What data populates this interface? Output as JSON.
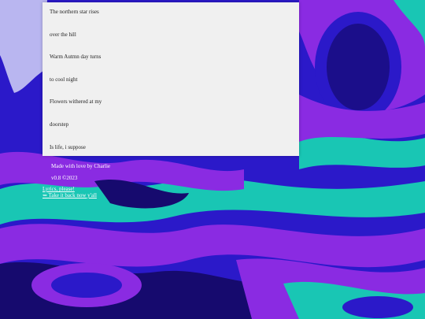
{
  "lyrics": [
    "The northern star rises",
    "over the hill",
    "Warm Autmn day turns",
    "to cool night",
    "Flowers withered at my",
    "doorstep",
    "Is life, i suppose"
  ],
  "footer": {
    "credit": "Made with love by Charlie",
    "version": "v0.8 ©2023",
    "lyrics_link": "Lyrics, please!",
    "back_link": "⇐ Take it back now y'all"
  },
  "colors": {
    "deep_blue": "#2b19c9",
    "purple": "#8a2be2",
    "teal": "#19c6b4",
    "navy": "#160a6e",
    "lavender": "#b9b6f0",
    "panel": "#f0f0f0"
  }
}
